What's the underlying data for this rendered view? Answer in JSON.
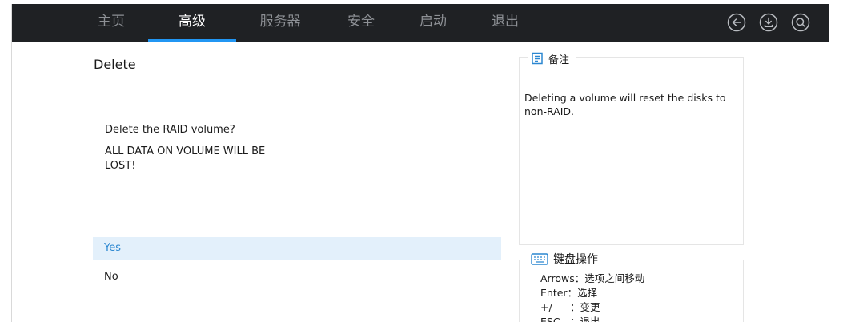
{
  "nav": {
    "tabs": [
      {
        "label": "主页",
        "active": false
      },
      {
        "label": "高级",
        "active": true
      },
      {
        "label": "服务器",
        "active": false
      },
      {
        "label": "安全",
        "active": false
      },
      {
        "label": "启动",
        "active": false
      },
      {
        "label": "退出",
        "active": false
      }
    ],
    "icons": [
      "back-icon",
      "save-icon",
      "search-icon"
    ]
  },
  "dialog": {
    "title": "Delete",
    "question": "Delete the RAID volume?",
    "warning": "ALL DATA ON VOLUME WILL BE LOST!",
    "options": [
      {
        "label": "Yes",
        "selected": true
      },
      {
        "label": "No",
        "selected": false
      }
    ]
  },
  "note": {
    "header": "备注",
    "text": "Deleting a volume will reset the disks to non-RAID."
  },
  "keyboard": {
    "header": "键盘操作",
    "rows": [
      {
        "key": "Arrows",
        "desc": "：选项之间移动"
      },
      {
        "key": "Enter",
        "desc": "：选择"
      },
      {
        "key": "+/-",
        "desc": "：变更"
      },
      {
        "key": "ESC",
        "desc": "：退出"
      }
    ]
  },
  "colors": {
    "navbar": "#1f2124",
    "accent": "#2196f3",
    "selected_bg": "#e3f0fb",
    "selected_text": "#2b87d1"
  }
}
